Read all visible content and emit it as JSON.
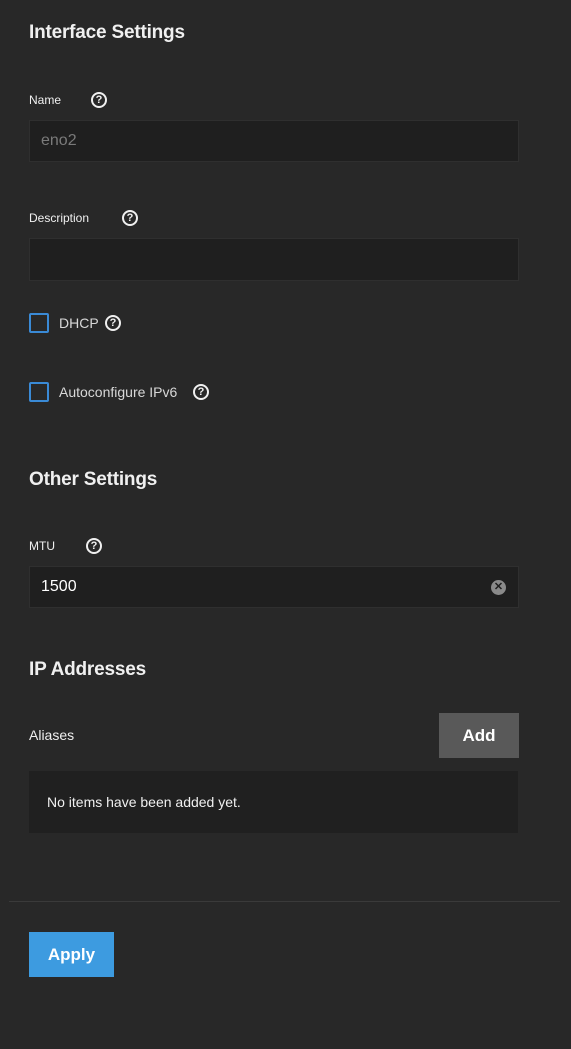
{
  "interface_settings": {
    "title": "Interface Settings",
    "name": {
      "label": "Name",
      "value": "eno2"
    },
    "description": {
      "label": "Description",
      "value": ""
    },
    "dhcp": {
      "label": "DHCP",
      "checked": false
    },
    "autoconfigure_ipv6": {
      "label": "Autoconfigure IPv6",
      "checked": false
    }
  },
  "other_settings": {
    "title": "Other Settings",
    "mtu": {
      "label": "MTU",
      "value": "1500"
    }
  },
  "ip_addresses": {
    "title": "IP Addresses",
    "aliases_label": "Aliases",
    "add_label": "Add",
    "empty_text": "No items have been added yet."
  },
  "footer": {
    "apply_label": "Apply"
  },
  "help_glyph": "?",
  "clear_glyph": "✕",
  "colors": {
    "accent": "#3d9be0",
    "background": "#282828",
    "input_bg": "#1f1f1f",
    "checkbox_border": "#3a8ad6"
  }
}
